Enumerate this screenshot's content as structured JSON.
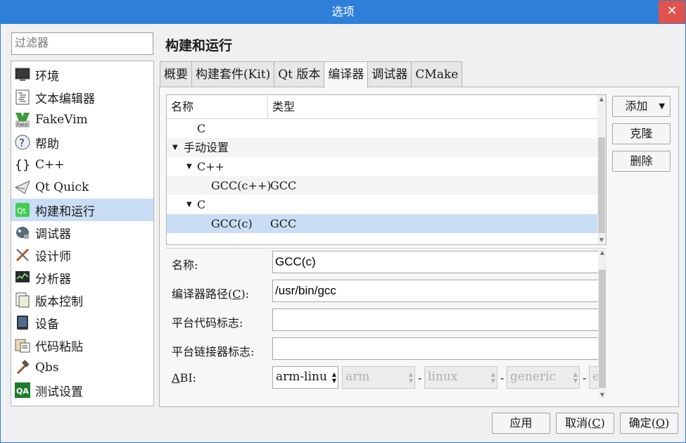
{
  "window": {
    "title": "选项",
    "close_glyph": "✕"
  },
  "filter": {
    "placeholder": "过滤器"
  },
  "categories": [
    {
      "label": "环境",
      "icon": "monitor-icon"
    },
    {
      "label": "文本编辑器",
      "icon": "text-editor-icon"
    },
    {
      "label": "FakeVim",
      "icon": "fakevim-icon"
    },
    {
      "label": "帮助",
      "icon": "help-icon"
    },
    {
      "label": "C++",
      "icon": "braces-icon"
    },
    {
      "label": "Qt Quick",
      "icon": "paper-plane-icon"
    },
    {
      "label": "构建和运行",
      "icon": "qt-build-icon",
      "selected": true
    },
    {
      "label": "调试器",
      "icon": "debugger-icon"
    },
    {
      "label": "设计师",
      "icon": "designer-icon"
    },
    {
      "label": "分析器",
      "icon": "analyzer-icon"
    },
    {
      "label": "版本控制",
      "icon": "version-control-icon"
    },
    {
      "label": "设备",
      "icon": "device-icon"
    },
    {
      "label": "代码粘贴",
      "icon": "code-paste-icon"
    },
    {
      "label": "Qbs",
      "icon": "hammer-icon"
    },
    {
      "label": "测试设置",
      "icon": "qa-icon"
    }
  ],
  "page_title": "构建和运行",
  "tabs": [
    {
      "label": "概要"
    },
    {
      "label": "构建套件(Kit)"
    },
    {
      "label": "Qt 版本"
    },
    {
      "label": "编译器",
      "active": true
    },
    {
      "label": "调试器"
    },
    {
      "label": "CMake"
    }
  ],
  "compiler_tree": {
    "headers": {
      "name": "名称",
      "type": "类型"
    },
    "rows": [
      {
        "name": "C",
        "type": ""
      },
      {
        "name": "手动设置",
        "type": ""
      },
      {
        "name": "C++",
        "type": ""
      },
      {
        "name": "GCC(c++)",
        "type": "GCC"
      },
      {
        "name": "C",
        "type": ""
      },
      {
        "name": "GCC(c)",
        "type": "GCC"
      }
    ]
  },
  "side_buttons": {
    "add": "添加",
    "clone": "克隆",
    "remove": "删除"
  },
  "details": {
    "name_label": "名称:",
    "name_value": "GCC(c)",
    "path_label_pre": "编译器路径(",
    "path_label_key": "C",
    "path_label_post": "):",
    "path_value": "/usr/bin/gcc",
    "platform_code_label": "平台代码标志:",
    "platform_code_value": "",
    "platform_linker_label": "平台链接器标志:",
    "platform_linker_value": "",
    "abi_label_key": "A",
    "abi_label_rest": "BI:",
    "abi": {
      "main": "arm-linu",
      "arch": "arm",
      "os": "linux",
      "flavor": "generic",
      "format": "e"
    }
  },
  "footer": {
    "apply": "应用",
    "cancel_pre": "取消(",
    "cancel_key": "C",
    "cancel_post": ")",
    "ok_pre": "确定(",
    "ok_key": "O",
    "ok_post": ")"
  },
  "colors": {
    "titlebar": "#2e7fd8",
    "selection": "#c9def5",
    "close": "#e0524c"
  }
}
